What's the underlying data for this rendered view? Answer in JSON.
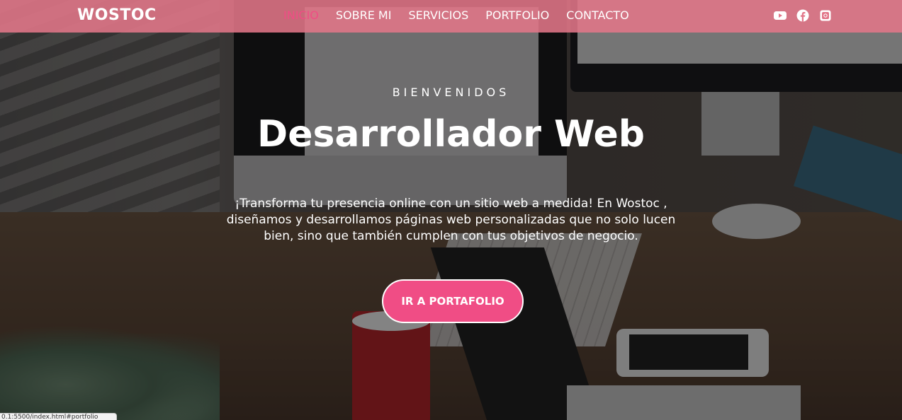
{
  "navbar": {
    "brand": "WOSTOC",
    "links": [
      {
        "label": "INICIO",
        "active": true
      },
      {
        "label": "SOBRE MI",
        "active": false
      },
      {
        "label": "SERVICIOS",
        "active": false
      },
      {
        "label": "PORTFOLIO",
        "active": false
      },
      {
        "label": "CONTACTO",
        "active": false
      }
    ],
    "social_icons": [
      "youtube-icon",
      "facebook-icon",
      "instagram-icon"
    ],
    "background_color": "#e27689",
    "active_color": "#f04d85"
  },
  "hero": {
    "eyebrow": "BIENVENIDOS",
    "title": "Desarrollador Web",
    "description": "¡Transforma tu presencia online con un sitio web a medida! En Wostoc , diseñamos y desarrollamos páginas web personalizadas que no solo lucen bien, sino que también cumplen con tus objetivos de negocio.",
    "cta_label": "IR A PORTAFOLIO",
    "cta_color": "#f04d85"
  },
  "status_bar": {
    "url": "0.1:5500/index.html#portfolio"
  }
}
